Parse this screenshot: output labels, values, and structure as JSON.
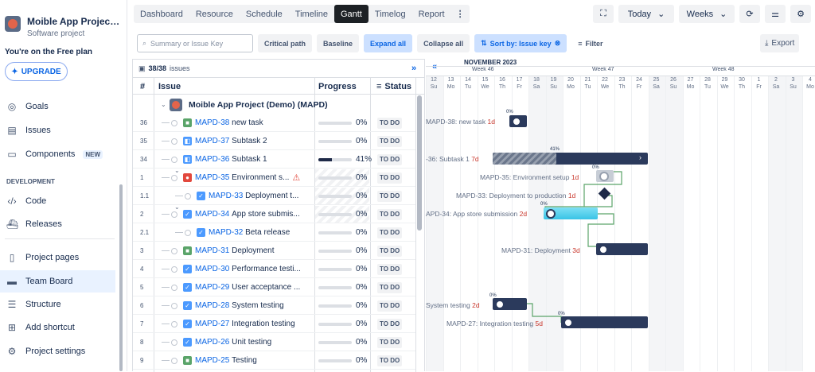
{
  "sidebar": {
    "project_name": "Moible App Project (Demo)",
    "project_type": "Software project",
    "plan": "You're on the Free plan",
    "upgrade": "UPGRADE",
    "nav": [
      {
        "label": "Goals",
        "icon": "target-icon"
      },
      {
        "label": "Issues",
        "icon": "issues-icon"
      },
      {
        "label": "Components",
        "icon": "components-icon",
        "badge": "NEW"
      }
    ],
    "section_development": "DEVELOPMENT",
    "dev_nav": [
      {
        "label": "Code",
        "icon": "code-icon"
      },
      {
        "label": "Releases",
        "icon": "ship-icon"
      }
    ],
    "bottom_nav": [
      {
        "label": "Project pages",
        "icon": "page-icon"
      },
      {
        "label": "Team Board",
        "icon": "board-icon",
        "active": true
      },
      {
        "label": "Structure",
        "icon": "structure-icon"
      },
      {
        "label": "Add shortcut",
        "icon": "add-shortcut-icon"
      },
      {
        "label": "Project settings",
        "icon": "gear-icon"
      }
    ]
  },
  "tabs": [
    "Dashboard",
    "Resource",
    "Schedule",
    "Timeline",
    "Gantt",
    "Timelog",
    "Report"
  ],
  "active_tab": "Gantt",
  "top_controls": {
    "today": "Today",
    "weeks": "Weeks"
  },
  "toolbar": {
    "search_placeholder": "Summary or Issue Key",
    "critical_path": "Critical path",
    "baseline": "Baseline",
    "expand_all": "Expand all",
    "collapse_all": "Collapse all",
    "sort_by": "Sort by: Issue key",
    "filter": "Filter",
    "export": "Export"
  },
  "grid": {
    "count": "38/38",
    "count_label": "issues",
    "headers": {
      "num": "#",
      "issue": "Issue",
      "progress": "Progress",
      "status": "Status"
    },
    "group": {
      "label": "Moible App Project (Demo)",
      "key": "(MAPD)"
    },
    "rows": [
      {
        "num": "36",
        "key": "MAPD-38",
        "title": "new task",
        "progress": "0%",
        "value": 0,
        "status": "TO DO",
        "level": 1,
        "type": "story"
      },
      {
        "num": "35",
        "key": "MAPD-37",
        "title": "Subtask 2",
        "progress": "0%",
        "value": 0,
        "status": "TO DO",
        "level": 1,
        "type": "subtask"
      },
      {
        "num": "34",
        "key": "MAPD-36",
        "title": "Subtask 1",
        "progress": "41%",
        "value": 41,
        "status": "TO DO",
        "level": 1,
        "type": "subtask"
      },
      {
        "num": "1",
        "key": "MAPD-35",
        "title": "Environment s...",
        "progress": "0%",
        "value": 0,
        "status": "TO DO",
        "level": 1,
        "type": "bug",
        "warn": true,
        "hatched": true
      },
      {
        "num": "1.1",
        "key": "MAPD-33",
        "title": "Deployment t...",
        "progress": "0%",
        "value": 0,
        "status": "TO DO",
        "level": 2,
        "type": "task",
        "hatched": true
      },
      {
        "num": "2",
        "key": "MAPD-34",
        "title": "App store submis...",
        "progress": "0%",
        "value": 0,
        "status": "TO DO",
        "level": 1,
        "type": "task",
        "hatched": true
      },
      {
        "num": "2.1",
        "key": "MAPD-32",
        "title": "Beta release",
        "progress": "0%",
        "value": 0,
        "status": "TO DO",
        "level": 2,
        "type": "task"
      },
      {
        "num": "3",
        "key": "MAPD-31",
        "title": "Deployment",
        "progress": "0%",
        "value": 0,
        "status": "TO DO",
        "level": 1,
        "type": "story"
      },
      {
        "num": "4",
        "key": "MAPD-30",
        "title": "Performance testi...",
        "progress": "0%",
        "value": 0,
        "status": "TO DO",
        "level": 1,
        "type": "task"
      },
      {
        "num": "5",
        "key": "MAPD-29",
        "title": "User acceptance ...",
        "progress": "0%",
        "value": 0,
        "status": "TO DO",
        "level": 1,
        "type": "task"
      },
      {
        "num": "6",
        "key": "MAPD-28",
        "title": "System testing",
        "progress": "0%",
        "value": 0,
        "status": "TO DO",
        "level": 1,
        "type": "task"
      },
      {
        "num": "7",
        "key": "MAPD-27",
        "title": "Integration testing",
        "progress": "0%",
        "value": 0,
        "status": "TO DO",
        "level": 1,
        "type": "task"
      },
      {
        "num": "8",
        "key": "MAPD-26",
        "title": "Unit testing",
        "progress": "0%",
        "value": 0,
        "status": "TO DO",
        "level": 1,
        "type": "task"
      },
      {
        "num": "9",
        "key": "MAPD-25",
        "title": "Testing",
        "progress": "0%",
        "value": 0,
        "status": "TO DO",
        "level": 1,
        "type": "story"
      }
    ]
  },
  "gantt": {
    "month": "NOVEMBER 2023",
    "weeks": [
      "Week 46",
      "Week 47",
      "Week 48"
    ],
    "days": [
      {
        "n": "12",
        "d": "Su"
      },
      {
        "n": "13",
        "d": "Mo"
      },
      {
        "n": "14",
        "d": "Tu"
      },
      {
        "n": "15",
        "d": "We"
      },
      {
        "n": "16",
        "d": "Th"
      },
      {
        "n": "17",
        "d": "Fr"
      },
      {
        "n": "18",
        "d": "Sa"
      },
      {
        "n": "19",
        "d": "Su"
      },
      {
        "n": "20",
        "d": "Mo"
      },
      {
        "n": "21",
        "d": "Tu"
      },
      {
        "n": "22",
        "d": "We"
      },
      {
        "n": "23",
        "d": "Th"
      },
      {
        "n": "24",
        "d": "Fr"
      },
      {
        "n": "25",
        "d": "Sa"
      },
      {
        "n": "26",
        "d": "Su"
      },
      {
        "n": "27",
        "d": "Mo"
      },
      {
        "n": "28",
        "d": "Tu"
      },
      {
        "n": "29",
        "d": "We"
      },
      {
        "n": "30",
        "d": "Th"
      },
      {
        "n": "1",
        "d": "Fr"
      },
      {
        "n": "2",
        "d": "Sa"
      },
      {
        "n": "3",
        "d": "Su"
      },
      {
        "n": "4",
        "d": "Mo"
      }
    ],
    "labels": {
      "r0": "MAPD-38: new task",
      "r0d": "1d",
      "r2": "-36: Subtask 1",
      "r2d": "7d",
      "r3": "MAPD-35: Environment setup",
      "r3d": "1d",
      "r4": "MAPD-33: Deployment to production",
      "r4d": "1d",
      "r5": "APD-34: App store submission",
      "r5d": "2d",
      "r7": "MAPD-31: Deployment",
      "r7d": "3d",
      "r10": "System testing",
      "r10d": "2d",
      "r11": "MAPD-27: Integration testing",
      "r11d": "5d"
    },
    "pcts": {
      "p0": "0%",
      "p2": "41%",
      "p3": "0%",
      "p5": "0%",
      "p10": "0%",
      "p11": "0%"
    }
  }
}
